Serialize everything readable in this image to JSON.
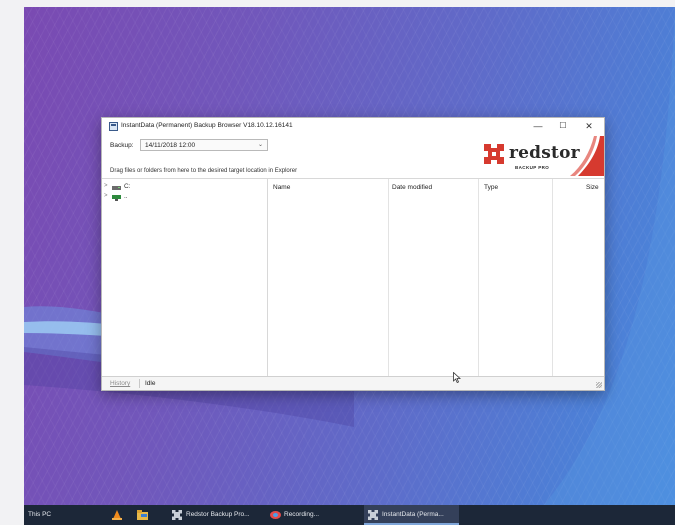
{
  "window": {
    "title": "InstantData (Permanent) Backup Browser V18.10.12.16141",
    "controls": {
      "minimize": "—",
      "maximize": "☐",
      "close": "✕"
    }
  },
  "backup": {
    "label": "Backup:",
    "selected": "14/11/2018 12:00"
  },
  "drag_hint": "Drag files or folders from here to the desired target location in Explorer",
  "logo": {
    "name": "redstor",
    "subtitle": "BACKUP PRO",
    "color": "#d63a2f"
  },
  "tree": {
    "items": [
      {
        "chevron": ">",
        "label": "C:",
        "icon": "drive-icon"
      },
      {
        "chevron": ">",
        "label": "..",
        "icon": "network-drive-icon"
      }
    ]
  },
  "file_list": {
    "columns": [
      "Name",
      "Date modified",
      "Type",
      "Size"
    ],
    "rows": []
  },
  "status_bar": {
    "history_link": "History",
    "status": "Idle"
  },
  "taskbar": {
    "items": [
      {
        "label": "This PC",
        "icon": "this-pc-icon"
      },
      {
        "label": "",
        "icon": "vlc-icon"
      },
      {
        "label": "",
        "icon": "file-explorer-icon"
      },
      {
        "label": "Redstor Backup Pro...",
        "icon": "redstor-icon"
      },
      {
        "label": "Recording...",
        "icon": "recording-icon"
      },
      {
        "label": "InstantData (Perma...",
        "icon": "redstor-icon",
        "active": true
      }
    ]
  }
}
